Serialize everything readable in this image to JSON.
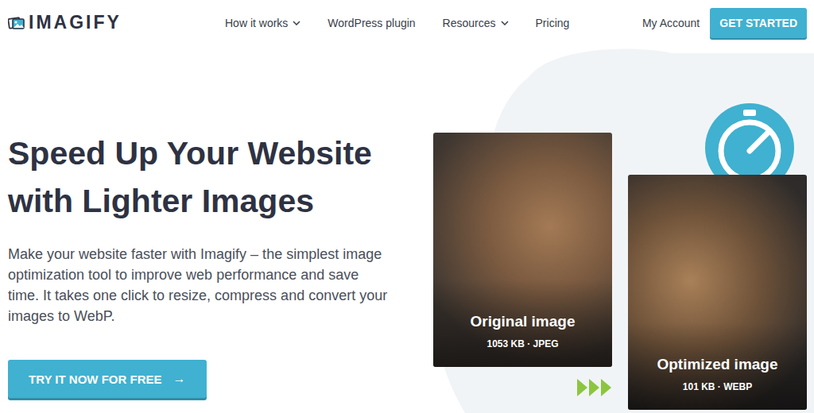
{
  "logo": {
    "text": "IMAGIFY"
  },
  "nav": {
    "items": [
      {
        "label": "How it works",
        "dropdown": true
      },
      {
        "label": "WordPress plugin",
        "dropdown": false
      },
      {
        "label": "Resources",
        "dropdown": true
      },
      {
        "label": "Pricing",
        "dropdown": false
      }
    ],
    "account": "My Account",
    "cta": "GET STARTED"
  },
  "hero": {
    "title_lines": [
      "Speed Up Your Website",
      "with Lighter Images"
    ],
    "description": "Make your website faster with Imagify – the simplest image optimization tool to improve web performance and save time. It takes one click to resize, compress and convert your images to WebP.",
    "cta": "TRY IT NOW FOR FREE",
    "cta_icon": "→"
  },
  "comparison": [
    {
      "label": "Original image",
      "meta": "1053 KB · JPEG"
    },
    {
      "label": "Optimized image",
      "meta": "101 KB · WEBP"
    }
  ]
}
